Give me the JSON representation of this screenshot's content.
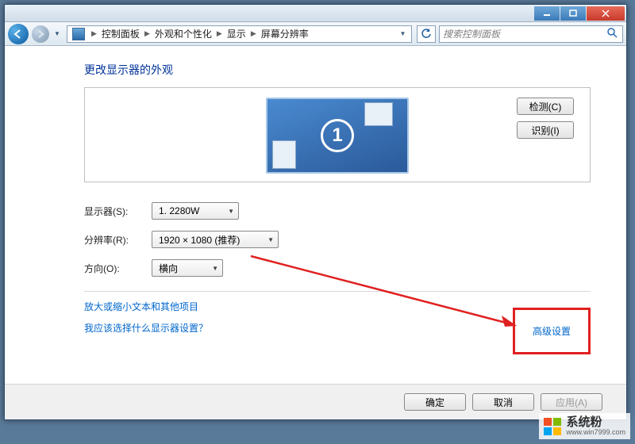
{
  "breadcrumb": {
    "items": [
      "控制面板",
      "外观和个性化",
      "显示",
      "屏幕分辨率"
    ]
  },
  "search": {
    "placeholder": "搜索控制面板"
  },
  "heading": "更改显示器的外观",
  "monitor_number": "1",
  "buttons": {
    "detect": "检测(C)",
    "identify": "识别(I)",
    "ok": "确定",
    "cancel": "取消",
    "apply": "应用(A)"
  },
  "labels": {
    "display": "显示器(S):",
    "resolution": "分辨率(R):",
    "orientation": "方向(O):"
  },
  "values": {
    "display": "1. 2280W",
    "resolution": "1920 × 1080 (推荐)",
    "orientation": "横向"
  },
  "links": {
    "advanced": "高级设置",
    "text_size": "放大或缩小文本和其他项目",
    "help": "我应该选择什么显示器设置？"
  },
  "watermark": {
    "brand": "系统粉",
    "url": "www.win7999.com"
  }
}
